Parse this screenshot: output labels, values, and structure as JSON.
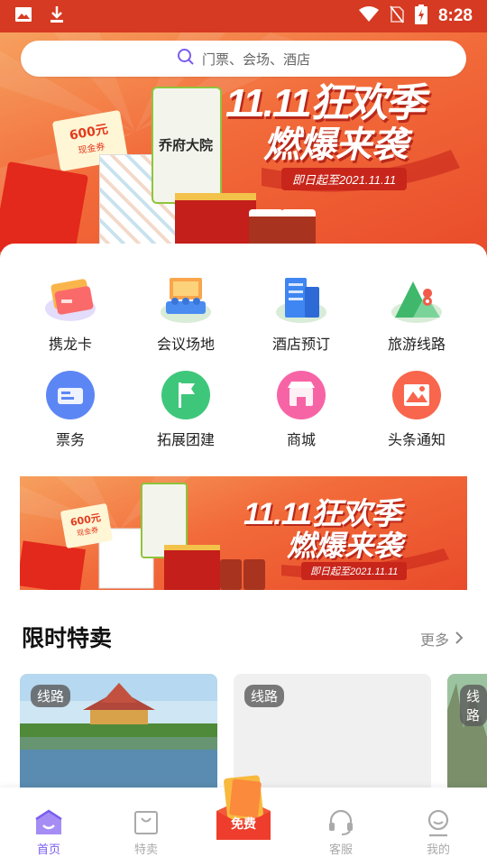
{
  "status_bar": {
    "time": "8:28"
  },
  "search": {
    "placeholder": "门票、会场、酒店"
  },
  "hero": {
    "title_line1": "11.11狂欢季",
    "title_line2": "燃爆来袭",
    "date_text": "即日起至2021.11.11",
    "coupon_amount": "600元",
    "coupon_label": "现金券",
    "product_label": "乔府大院"
  },
  "grid": [
    {
      "label": "携龙卡",
      "icon": "card-icon"
    },
    {
      "label": "会议场地",
      "icon": "venue-icon"
    },
    {
      "label": "酒店预订",
      "icon": "hotel-icon"
    },
    {
      "label": "旅游线路",
      "icon": "mountain-route-icon"
    },
    {
      "label": "票务",
      "icon": "ticket-icon"
    },
    {
      "label": "拓展团建",
      "icon": "flag-icon"
    },
    {
      "label": "商城",
      "icon": "shop-icon"
    },
    {
      "label": "头条通知",
      "icon": "news-icon"
    }
  ],
  "promo": {
    "title_line1": "11.11狂欢季",
    "title_line2": "燃爆来袭",
    "date_text": "即日起至2021.11.11",
    "coupon_amount": "600元",
    "coupon_label": "现金券"
  },
  "section": {
    "title": "限时特卖",
    "more": "更多"
  },
  "cards": [
    {
      "tag": "线路"
    },
    {
      "tag": "线路"
    },
    {
      "tag": "线路"
    }
  ],
  "bottom_nav": [
    {
      "label": "首页",
      "icon": "home-icon"
    },
    {
      "label": "特卖",
      "icon": "bag-icon"
    },
    {
      "label": "免费",
      "icon": "free-icon"
    },
    {
      "label": "客服",
      "icon": "headset-icon"
    },
    {
      "label": "我的",
      "icon": "profile-icon"
    }
  ],
  "colors": {
    "status_bar": "#d63a22",
    "accent": "#7a5cf0",
    "nav_inactive": "#aaaaaa"
  }
}
